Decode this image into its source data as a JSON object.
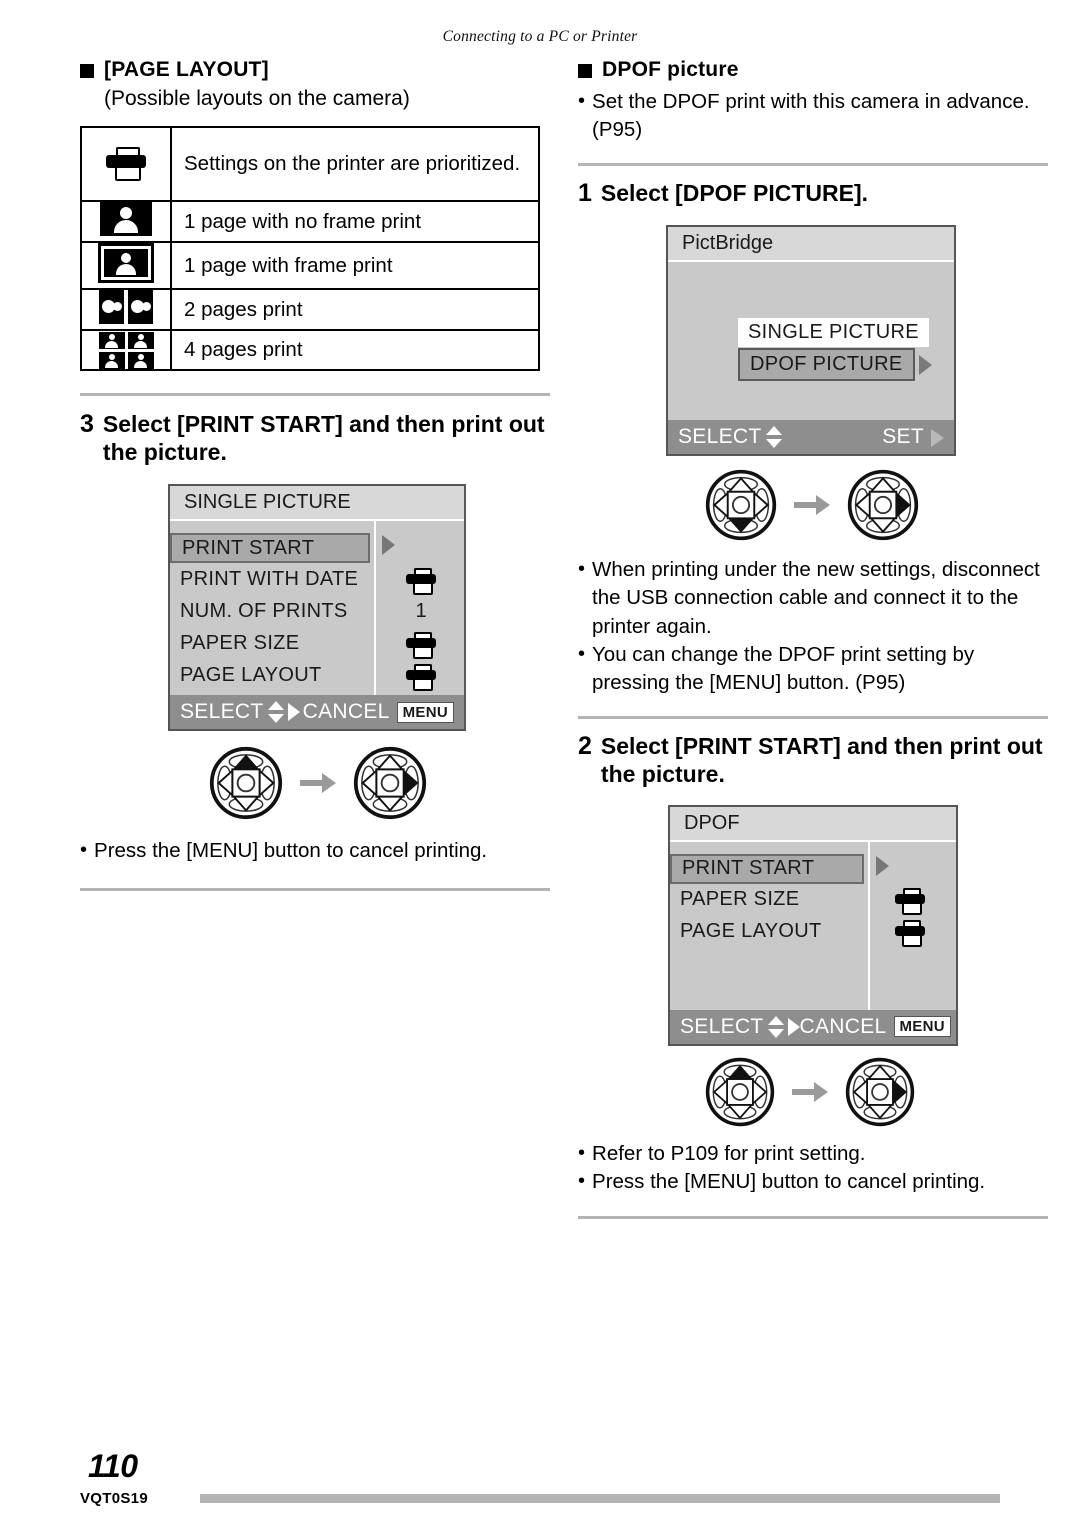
{
  "header": {
    "running_head": "Connecting to a PC or Printer"
  },
  "footer": {
    "page_number": "110",
    "doc_code": "VQT0S19"
  },
  "left_column": {
    "section": {
      "heading": "[PAGE LAYOUT]",
      "subheading": "(Possible layouts on the camera)"
    },
    "layout_table": {
      "rows": [
        {
          "icon": "printer-icon",
          "text": "Settings on the printer are prioritized."
        },
        {
          "icon": "one-page-no-frame-icon",
          "text": "1 page with no frame print"
        },
        {
          "icon": "one-page-with-frame-icon",
          "text": "1 page with frame print"
        },
        {
          "icon": "two-pages-icon",
          "text": "2 pages print"
        },
        {
          "icon": "four-pages-icon",
          "text": "4 pages print"
        }
      ]
    },
    "step": {
      "number": "3",
      "text": "Select [PRINT START] and then print out the picture."
    },
    "lcd": {
      "title": "SINGLE PICTURE",
      "rows": [
        {
          "label": "PRINT START",
          "value": "",
          "selected": true
        },
        {
          "label": "PRINT WITH DATE",
          "value": "printer-icon",
          "selected": false
        },
        {
          "label": "NUM. OF PRINTS",
          "value": "1",
          "selected": false
        },
        {
          "label": "PAPER SIZE",
          "value": "printer-icon",
          "selected": false
        },
        {
          "label": "PAGE LAYOUT",
          "value": "printer-icon",
          "selected": false
        }
      ],
      "footer_left": "SELECT",
      "footer_right": "CANCEL",
      "footer_key": "MENU"
    },
    "cursor_sequence": {
      "first": "up",
      "second": "right"
    },
    "notes": [
      "Press the [MENU] button to cancel printing."
    ]
  },
  "right_column": {
    "section": {
      "heading": "DPOF picture",
      "bullets": [
        "Set the DPOF print with this camera in advance. (P95)"
      ]
    },
    "step1": {
      "number": "1",
      "text": "Select [DPOF PICTURE]."
    },
    "lcd_pictbridge": {
      "title": "PictBridge",
      "options": [
        {
          "label": "SINGLE PICTURE",
          "selected": false
        },
        {
          "label": "DPOF PICTURE",
          "selected": true
        }
      ],
      "footer_left": "SELECT",
      "footer_right": "SET"
    },
    "cursor_sequence_1": {
      "first": "down",
      "second": "right"
    },
    "notes_middle": [
      "When printing under the new settings, disconnect the USB connection cable and connect it to the printer again.",
      "You can change the DPOF print setting by pressing the [MENU] button. (P95)"
    ],
    "step2": {
      "number": "2",
      "text": "Select [PRINT START] and then print out the picture."
    },
    "lcd_dpof": {
      "title": "DPOF",
      "rows": [
        {
          "label": "PRINT START",
          "value": "",
          "selected": true
        },
        {
          "label": "PAPER SIZE",
          "value": "printer-icon",
          "selected": false
        },
        {
          "label": "PAGE LAYOUT",
          "value": "printer-icon",
          "selected": false
        }
      ],
      "footer_left": "SELECT",
      "footer_right": "CANCEL",
      "footer_key": "MENU"
    },
    "cursor_sequence_2": {
      "first": "up",
      "second": "right"
    },
    "notes_bottom": [
      "Refer to P109 for print setting.",
      "Press the [MENU] button to cancel printing."
    ]
  },
  "colors": {
    "rule": "#b4b4b4",
    "lcd_bg": "#c9c9c9",
    "lcd_title_bg": "#d8d8d8",
    "lcd_footer_bg": "#8e8e8e",
    "lcd_selected_bg": "#a9a9a9"
  }
}
